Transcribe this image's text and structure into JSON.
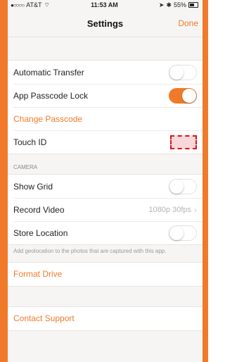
{
  "statusbar": {
    "carrier": "AT&T",
    "time": "11:53 AM",
    "battery": "55%"
  },
  "navbar": {
    "title": "Settings",
    "done": "Done"
  },
  "general": {
    "automatic_transfer": "Automatic Transfer",
    "passcode_lock": "App Passcode Lock",
    "change_passcode": "Change Passcode",
    "touch_id": "Touch ID"
  },
  "camera": {
    "header": "CAMERA",
    "show_grid": "Show Grid",
    "record_video": "Record Video",
    "record_video_value": "1080p 30fps",
    "store_location": "Store Location",
    "footer": "Add geolocation to the photos that are captured with this app."
  },
  "actions": {
    "format_drive": "Format Drive",
    "contact_support": "Contact Support"
  },
  "toggles": {
    "automatic_transfer": false,
    "passcode_lock": true,
    "show_grid": false,
    "store_location": false
  },
  "colors": {
    "accent": "#f07a2a",
    "highlight": "#d8141f"
  }
}
